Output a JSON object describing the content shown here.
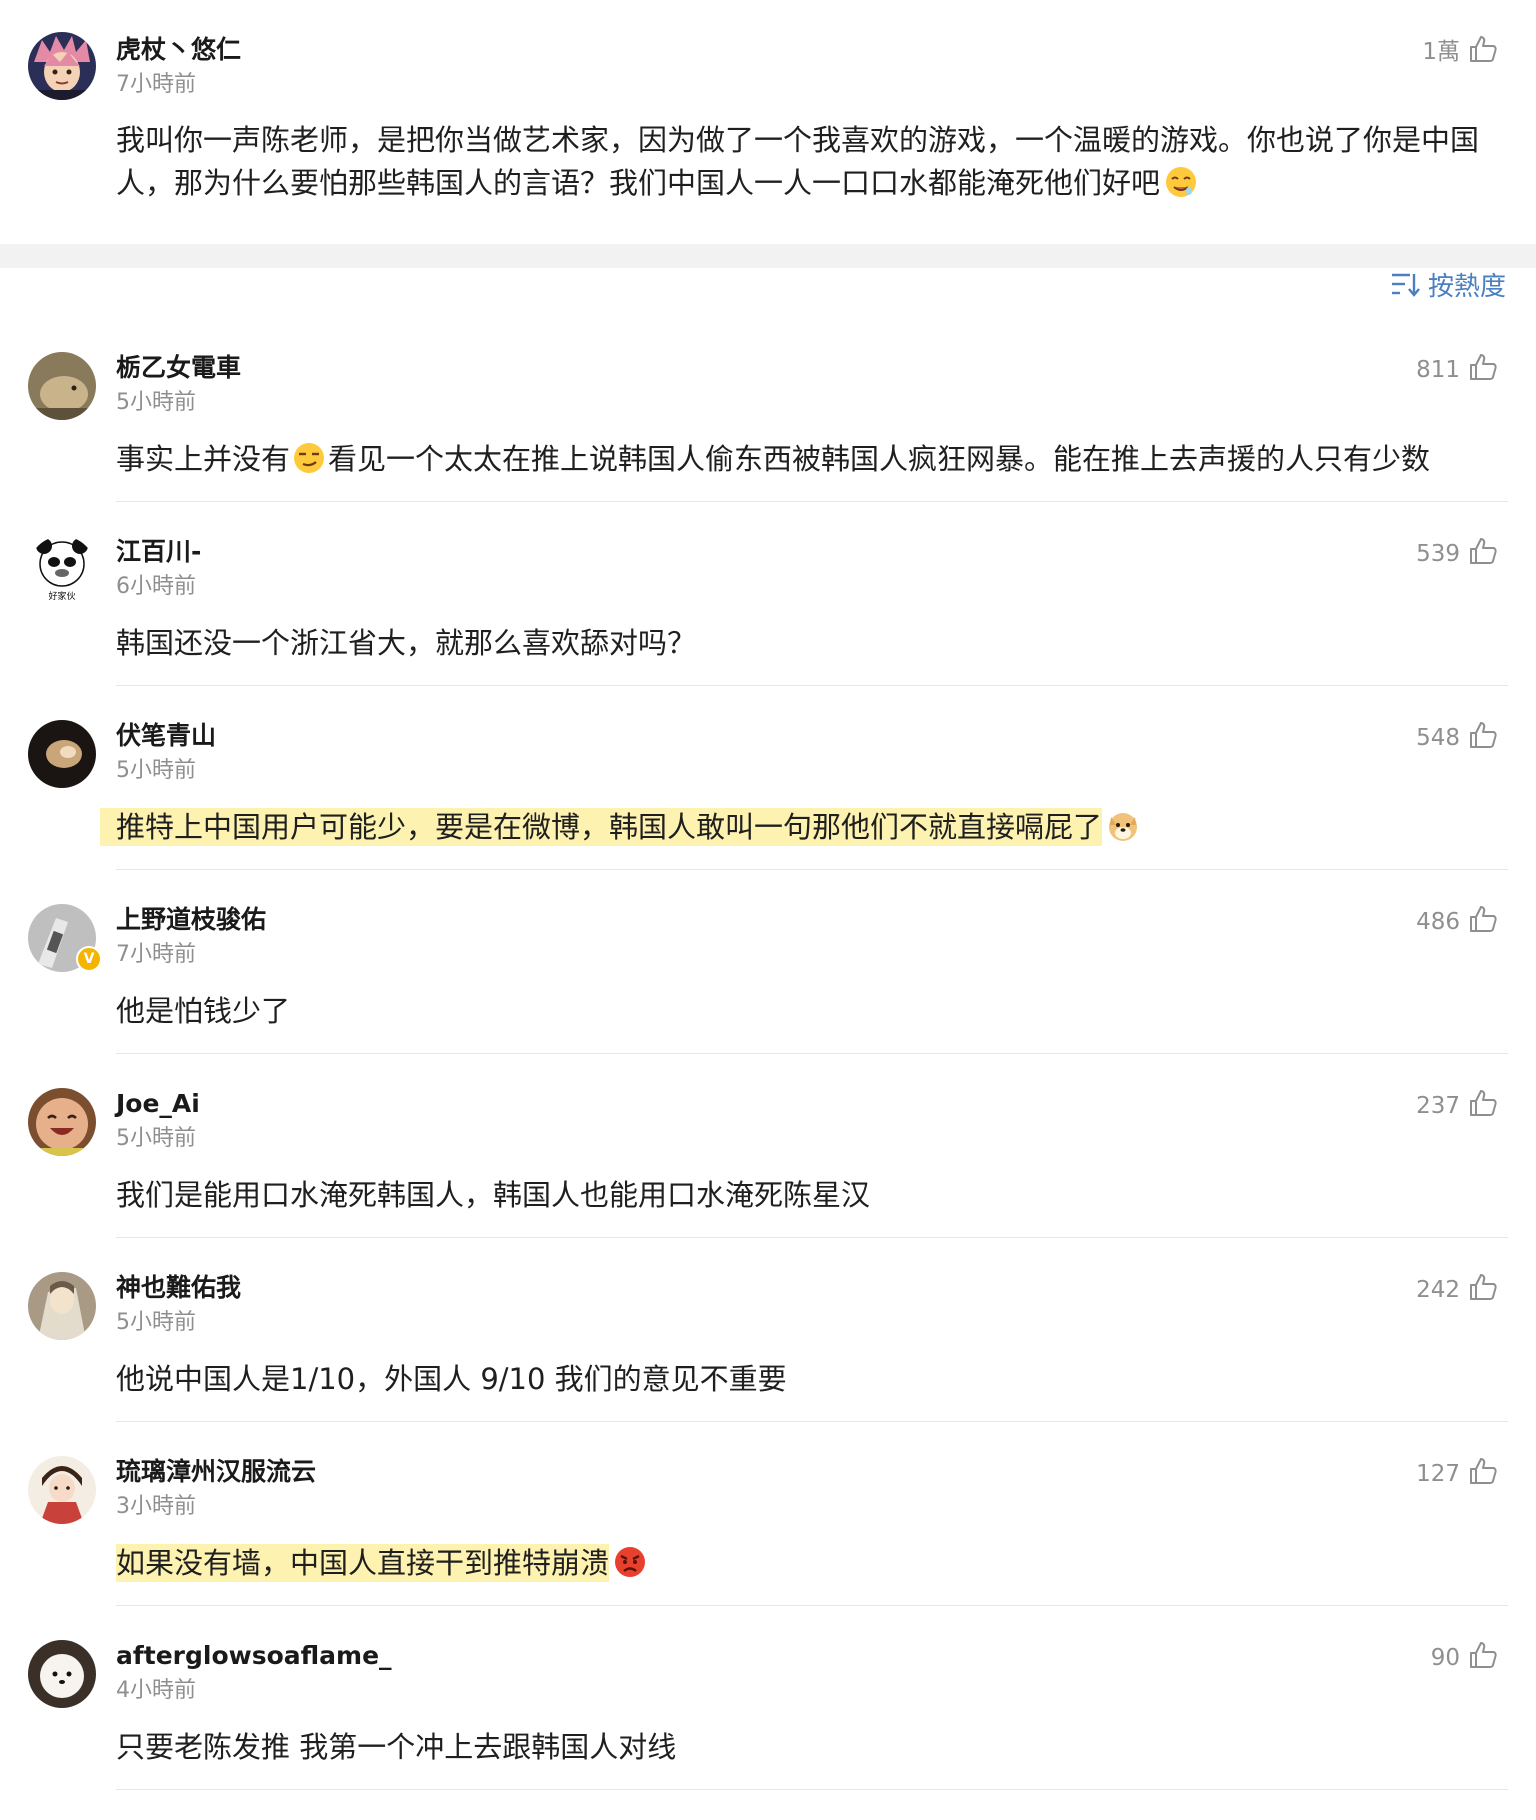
{
  "top_comment": {
    "author": "虎杖丶悠仁",
    "time": "7小時前",
    "likes": "1萬",
    "text": "我叫你一声陈老师，是把你当做艺术家，因为做了一个我喜欢的游戏，一个温暖的游戏。你也说了你是中国人，那为什么要怕那些韩国人的言语？我们中国人一人一口口水都能淹死他们好吧",
    "avatar": "pink-hair-anime-avatar",
    "emoji": "drooling-face-emoji"
  },
  "sort": {
    "label": "按熱度",
    "icon": "sort-lines-icon"
  },
  "colors": {
    "link": "#4a7fc1",
    "highlight": "#fdf2b0",
    "muted": "#8f8f8f",
    "divider": "#e6e6e6",
    "verified": "#f5b400"
  },
  "comments": [
    {
      "author": "栃乙女電車",
      "time": "5小時前",
      "likes": "811",
      "text_before": "事实上并没有",
      "emoji": "smirk-face-emoji",
      "text_after": "看见一个太太在推上说韩国人偷东西被韩国人疯狂网暴。能在推上去声援的人只有少数"
    },
    {
      "author": "江百川-",
      "time": "6小時前",
      "likes": "539",
      "text": "韩国还没一个浙江省大，就那么喜欢舔对吗？",
      "avatar_caption": "好家伙"
    },
    {
      "author": "伏笔青山",
      "time": "5小時前",
      "likes": "548",
      "text": "推特上中国用户可能少，要是在微博，韩国人敢叫一句那他们不就直接嗝屁了",
      "emoji": "doge-emoji"
    },
    {
      "author": "上野道枝骏佑",
      "time": "7小時前",
      "likes": "486",
      "text": "他是怕钱少了",
      "badge": "V"
    },
    {
      "author": "Joe_Ai",
      "time": "5小時前",
      "likes": "237",
      "text": "我们是能用口水淹死韩国人，韩国人也能用口水淹死陈星汉"
    },
    {
      "author": "神也難佑我",
      "time": "5小時前",
      "likes": "242",
      "text": "他说中国人是1/10，外国人 9/10 我们的意见不重要"
    },
    {
      "author": "琉璃漳州汉服流云",
      "time": "3小時前",
      "likes": "127",
      "text": "如果没有墙，中国人直接干到推特崩溃",
      "emoji": "angry-face-emoji"
    },
    {
      "author": "afterglowsoaflame_",
      "time": "4小時前",
      "likes": "90",
      "text": "只要老陈发推 我第一个冲上去跟韩国人对线"
    }
  ]
}
